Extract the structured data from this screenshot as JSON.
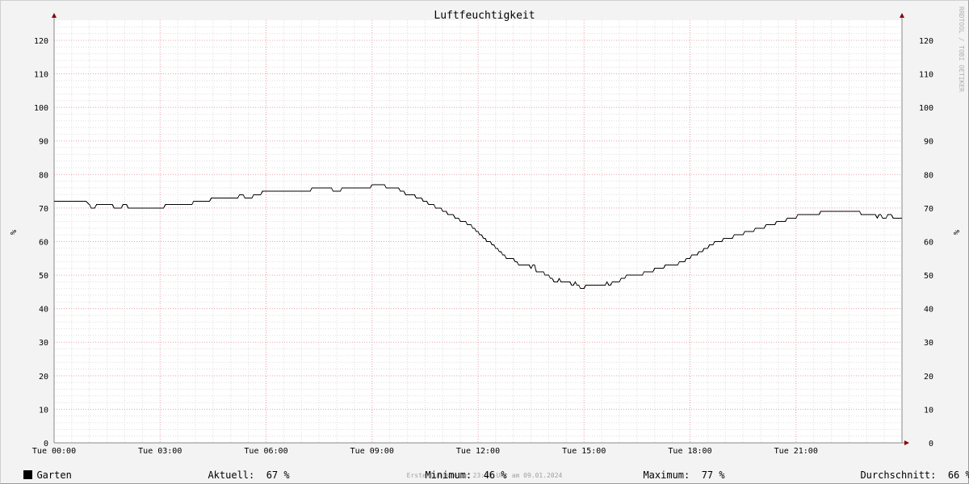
{
  "chart_data": {
    "type": "line",
    "title": "Luftfeuchtigkeit",
    "ylabel": "%",
    "xlabel": "",
    "ylim": [
      0,
      126
    ],
    "xlim": [
      0,
      24
    ],
    "y_ticks": [
      0,
      10,
      20,
      30,
      40,
      50,
      60,
      70,
      80,
      90,
      100,
      110,
      120
    ],
    "x_ticks": [
      {
        "t": 0,
        "label": "Tue 00:00"
      },
      {
        "t": 3,
        "label": "Tue 03:00"
      },
      {
        "t": 6,
        "label": "Tue 06:00"
      },
      {
        "t": 9,
        "label": "Tue 09:00"
      },
      {
        "t": 12,
        "label": "Tue 12:00"
      },
      {
        "t": 15,
        "label": "Tue 15:00"
      },
      {
        "t": 18,
        "label": "Tue 18:00"
      },
      {
        "t": 21,
        "label": "Tue 21:00"
      }
    ],
    "grid": true,
    "watermark": "RRDTOOL / TOBI OETIKER",
    "series": [
      {
        "name": "Garten",
        "color": "#000000",
        "points": [
          [
            0,
            72
          ],
          [
            0.9,
            72
          ],
          [
            1.0,
            71
          ],
          [
            1.05,
            70
          ],
          [
            1.15,
            70
          ],
          [
            1.2,
            71
          ],
          [
            1.65,
            71
          ],
          [
            1.7,
            70
          ],
          [
            1.9,
            70
          ],
          [
            1.95,
            71
          ],
          [
            2.05,
            71
          ],
          [
            2.1,
            70
          ],
          [
            3.1,
            70
          ],
          [
            3.15,
            71
          ],
          [
            3.9,
            71
          ],
          [
            3.95,
            72
          ],
          [
            4.4,
            72
          ],
          [
            4.45,
            73
          ],
          [
            5.2,
            73
          ],
          [
            5.25,
            74
          ],
          [
            5.35,
            74
          ],
          [
            5.4,
            73
          ],
          [
            5.6,
            73
          ],
          [
            5.65,
            74
          ],
          [
            5.85,
            74
          ],
          [
            5.9,
            75
          ],
          [
            7.25,
            75
          ],
          [
            7.3,
            76
          ],
          [
            7.85,
            76
          ],
          [
            7.9,
            75
          ],
          [
            8.1,
            75
          ],
          [
            8.15,
            76
          ],
          [
            8.95,
            76
          ],
          [
            9.0,
            77
          ],
          [
            9.35,
            77
          ],
          [
            9.4,
            76
          ],
          [
            9.75,
            76
          ],
          [
            9.8,
            75
          ],
          [
            9.9,
            75
          ],
          [
            9.95,
            74
          ],
          [
            10.2,
            74
          ],
          [
            10.25,
            73
          ],
          [
            10.4,
            73
          ],
          [
            10.45,
            72
          ],
          [
            10.55,
            72
          ],
          [
            10.6,
            71
          ],
          [
            10.75,
            71
          ],
          [
            10.8,
            70
          ],
          [
            10.95,
            70
          ],
          [
            11.0,
            69
          ],
          [
            11.1,
            69
          ],
          [
            11.15,
            68
          ],
          [
            11.3,
            68
          ],
          [
            11.35,
            67
          ],
          [
            11.45,
            67
          ],
          [
            11.5,
            66
          ],
          [
            11.65,
            66
          ],
          [
            11.7,
            65
          ],
          [
            11.8,
            65
          ],
          [
            11.85,
            64
          ],
          [
            11.9,
            64
          ],
          [
            11.95,
            63
          ],
          [
            12.0,
            63
          ],
          [
            12.05,
            62
          ],
          [
            12.1,
            62
          ],
          [
            12.15,
            61
          ],
          [
            12.2,
            61
          ],
          [
            12.25,
            60
          ],
          [
            12.35,
            60
          ],
          [
            12.4,
            59
          ],
          [
            12.45,
            59
          ],
          [
            12.5,
            58
          ],
          [
            12.55,
            58
          ],
          [
            12.6,
            57
          ],
          [
            12.65,
            57
          ],
          [
            12.7,
            56
          ],
          [
            12.75,
            56
          ],
          [
            12.8,
            55
          ],
          [
            13.0,
            55
          ],
          [
            13.05,
            54
          ],
          [
            13.1,
            54
          ],
          [
            13.15,
            53
          ],
          [
            13.45,
            53
          ],
          [
            13.5,
            52
          ],
          [
            13.55,
            53
          ],
          [
            13.6,
            53
          ],
          [
            13.65,
            51
          ],
          [
            13.85,
            51
          ],
          [
            13.9,
            50
          ],
          [
            14.0,
            50
          ],
          [
            14.05,
            49
          ],
          [
            14.1,
            49
          ],
          [
            14.15,
            48
          ],
          [
            14.25,
            48
          ],
          [
            14.3,
            49
          ],
          [
            14.35,
            48
          ],
          [
            14.6,
            48
          ],
          [
            14.65,
            47
          ],
          [
            14.7,
            47
          ],
          [
            14.75,
            48
          ],
          [
            14.8,
            47
          ],
          [
            14.85,
            47
          ],
          [
            14.9,
            46
          ],
          [
            15.0,
            46
          ],
          [
            15.05,
            47
          ],
          [
            15.6,
            47
          ],
          [
            15.65,
            48
          ],
          [
            15.7,
            47
          ],
          [
            15.75,
            47
          ],
          [
            15.8,
            48
          ],
          [
            16.0,
            48
          ],
          [
            16.05,
            49
          ],
          [
            16.15,
            49
          ],
          [
            16.2,
            50
          ],
          [
            16.65,
            50
          ],
          [
            16.7,
            51
          ],
          [
            16.95,
            51
          ],
          [
            17.0,
            52
          ],
          [
            17.25,
            52
          ],
          [
            17.3,
            53
          ],
          [
            17.65,
            53
          ],
          [
            17.7,
            54
          ],
          [
            17.85,
            54
          ],
          [
            17.9,
            55
          ],
          [
            18.0,
            55
          ],
          [
            18.05,
            56
          ],
          [
            18.2,
            56
          ],
          [
            18.25,
            57
          ],
          [
            18.35,
            57
          ],
          [
            18.4,
            58
          ],
          [
            18.5,
            58
          ],
          [
            18.55,
            59
          ],
          [
            18.65,
            59
          ],
          [
            18.7,
            60
          ],
          [
            18.9,
            60
          ],
          [
            18.95,
            61
          ],
          [
            19.2,
            61
          ],
          [
            19.25,
            62
          ],
          [
            19.5,
            62
          ],
          [
            19.55,
            63
          ],
          [
            19.8,
            63
          ],
          [
            19.85,
            64
          ],
          [
            20.1,
            64
          ],
          [
            20.15,
            65
          ],
          [
            20.4,
            65
          ],
          [
            20.45,
            66
          ],
          [
            20.7,
            66
          ],
          [
            20.75,
            67
          ],
          [
            21.0,
            67
          ],
          [
            21.05,
            68
          ],
          [
            21.65,
            68
          ],
          [
            21.7,
            69
          ],
          [
            22.8,
            69
          ],
          [
            22.85,
            68
          ],
          [
            23.25,
            68
          ],
          [
            23.3,
            67
          ],
          [
            23.35,
            68
          ],
          [
            23.4,
            68
          ],
          [
            23.45,
            67
          ],
          [
            23.55,
            67
          ],
          [
            23.6,
            68
          ],
          [
            23.7,
            68
          ],
          [
            23.75,
            67
          ],
          [
            24.0,
            67
          ]
        ]
      }
    ]
  },
  "legend": {
    "series_name": "Garten",
    "current_label": "Aktuell:",
    "current_value": "67 %",
    "min_label": "Minimum:",
    "min_value": "46 %",
    "max_label": "Maximum:",
    "max_value": "77 %",
    "avg_label": "Durchschnitt:",
    "avg_value": "66 %"
  },
  "footer": {
    "timestamp": "Erstellungszeit: 23:55 Uhr am 09.01.2024"
  },
  "colors": {
    "background": "#f3f3f3",
    "canvas": "#ffffff",
    "minor_grid": "#dddddd",
    "major_grid": "#e8a0a8",
    "axis": "#888888",
    "arrow": "#8b0000"
  }
}
